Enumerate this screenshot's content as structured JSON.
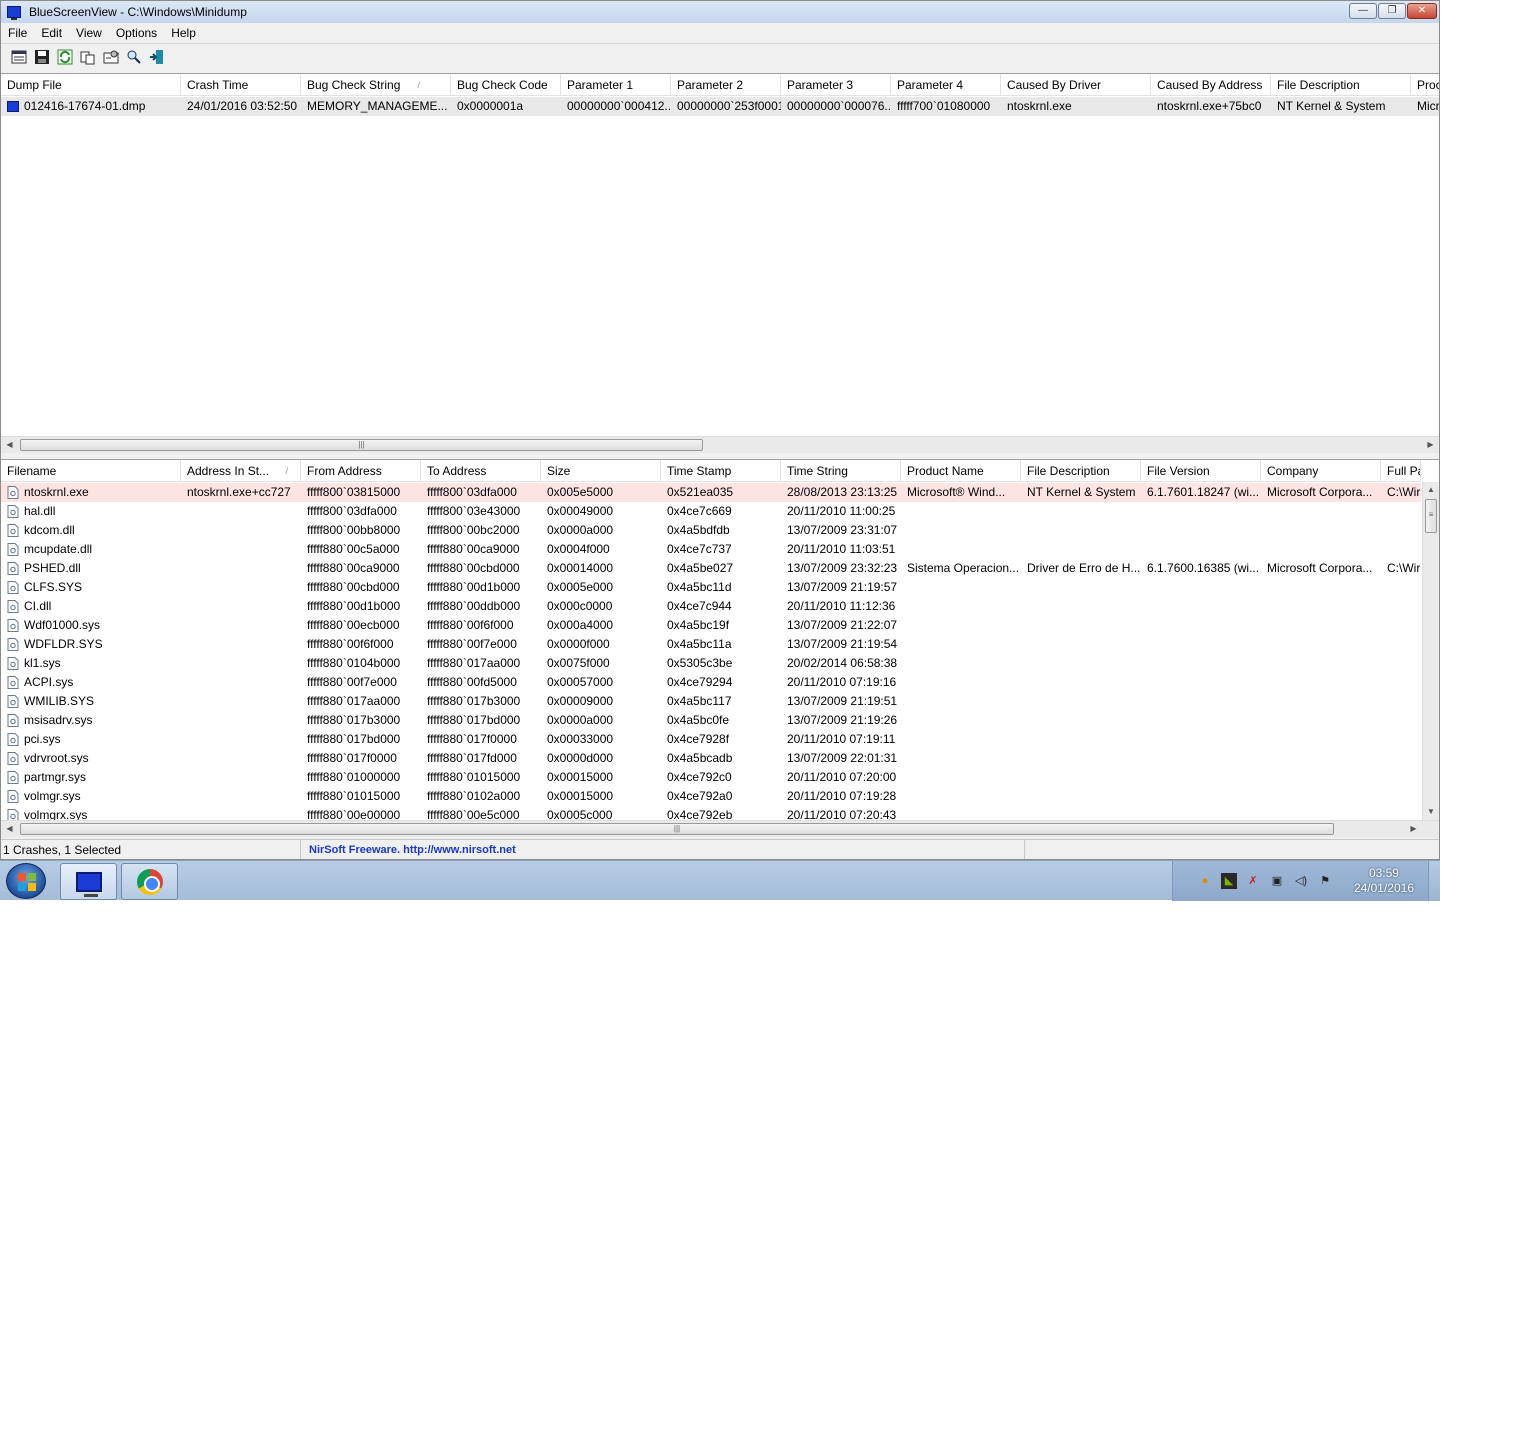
{
  "window": {
    "title": "BlueScreenView  -  C:\\Windows\\Minidump",
    "minimize": "—",
    "maximize": "❐",
    "close": "✕"
  },
  "menu": [
    "File",
    "Edit",
    "View",
    "Options",
    "Help"
  ],
  "toolbar": {
    "icons": [
      "properties-icon",
      "save-icon",
      "refresh-icon",
      "copy-icon",
      "advanced-options-icon",
      "find-icon",
      "exit-icon"
    ]
  },
  "upper": {
    "columns": [
      {
        "label": "Dump File",
        "w": 180
      },
      {
        "label": "Crash Time",
        "w": 120
      },
      {
        "label": "Bug Check String",
        "w": 150,
        "sort": "/"
      },
      {
        "label": "Bug Check Code",
        "w": 110
      },
      {
        "label": "Parameter 1",
        "w": 110
      },
      {
        "label": "Parameter 2",
        "w": 110
      },
      {
        "label": "Parameter 3",
        "w": 110
      },
      {
        "label": "Parameter 4",
        "w": 110
      },
      {
        "label": "Caused By Driver",
        "w": 150
      },
      {
        "label": "Caused By Address",
        "w": 120
      },
      {
        "label": "File Description",
        "w": 140
      },
      {
        "label": "Proc",
        "w": 40
      }
    ],
    "rows": [
      [
        "012416-17674-01.dmp",
        "24/01/2016 03:52:50",
        "MEMORY_MANAGEME...",
        "0x0000001a",
        "00000000`000412...",
        "00000000`253f0001",
        "00000000`000076...",
        "fffff700`01080000",
        "ntoskrnl.exe",
        "ntoskrnl.exe+75bc0",
        "NT Kernel & System",
        "Micr"
      ]
    ]
  },
  "lower": {
    "columns": [
      {
        "label": "Filename",
        "w": 180
      },
      {
        "label": "Address In St...",
        "w": 120,
        "sort": "/"
      },
      {
        "label": "From Address",
        "w": 120
      },
      {
        "label": "To Address",
        "w": 120
      },
      {
        "label": "Size",
        "w": 120
      },
      {
        "label": "Time Stamp",
        "w": 120
      },
      {
        "label": "Time String",
        "w": 120
      },
      {
        "label": "Product Name",
        "w": 120
      },
      {
        "label": "File Description",
        "w": 120
      },
      {
        "label": "File Version",
        "w": 120
      },
      {
        "label": "Company",
        "w": 120
      },
      {
        "label": "Full Pa",
        "w": 40
      }
    ],
    "rows": [
      [
        "ntoskrnl.exe",
        "ntoskrnl.exe+cc727",
        "fffff800`03815000",
        "fffff800`03dfa000",
        "0x005e5000",
        "0x521ea035",
        "28/08/2013 23:13:25",
        "Microsoft® Wind...",
        "NT Kernel & System",
        "6.1.7601.18247 (wi...",
        "Microsoft Corpora...",
        "C:\\Wir"
      ],
      [
        "hal.dll",
        "",
        "fffff800`03dfa000",
        "fffff800`03e43000",
        "0x00049000",
        "0x4ce7c669",
        "20/11/2010 11:00:25",
        "",
        "",
        "",
        "",
        ""
      ],
      [
        "kdcom.dll",
        "",
        "fffff800`00bb8000",
        "fffff800`00bc2000",
        "0x0000a000",
        "0x4a5bdfdb",
        "13/07/2009 23:31:07",
        "",
        "",
        "",
        "",
        ""
      ],
      [
        "mcupdate.dll",
        "",
        "fffff880`00c5a000",
        "fffff880`00ca9000",
        "0x0004f000",
        "0x4ce7c737",
        "20/11/2010 11:03:51",
        "",
        "",
        "",
        "",
        ""
      ],
      [
        "PSHED.dll",
        "",
        "fffff880`00ca9000",
        "fffff880`00cbd000",
        "0x00014000",
        "0x4a5be027",
        "13/07/2009 23:32:23",
        "Sistema Operacion...",
        "Driver de Erro de H...",
        "6.1.7600.16385 (wi...",
        "Microsoft Corpora...",
        "C:\\Wir"
      ],
      [
        "CLFS.SYS",
        "",
        "fffff880`00cbd000",
        "fffff880`00d1b000",
        "0x0005e000",
        "0x4a5bc11d",
        "13/07/2009 21:19:57",
        "",
        "",
        "",
        "",
        ""
      ],
      [
        "CI.dll",
        "",
        "fffff880`00d1b000",
        "fffff880`00ddb000",
        "0x000c0000",
        "0x4ce7c944",
        "20/11/2010 11:12:36",
        "",
        "",
        "",
        "",
        ""
      ],
      [
        "Wdf01000.sys",
        "",
        "fffff880`00ecb000",
        "fffff880`00f6f000",
        "0x000a4000",
        "0x4a5bc19f",
        "13/07/2009 21:22:07",
        "",
        "",
        "",
        "",
        ""
      ],
      [
        "WDFLDR.SYS",
        "",
        "fffff880`00f6f000",
        "fffff880`00f7e000",
        "0x0000f000",
        "0x4a5bc11a",
        "13/07/2009 21:19:54",
        "",
        "",
        "",
        "",
        ""
      ],
      [
        "kl1.sys",
        "",
        "fffff880`0104b000",
        "fffff880`017aa000",
        "0x0075f000",
        "0x5305c3be",
        "20/02/2014 06:58:38",
        "",
        "",
        "",
        "",
        ""
      ],
      [
        "ACPI.sys",
        "",
        "fffff880`00f7e000",
        "fffff880`00fd5000",
        "0x00057000",
        "0x4ce79294",
        "20/11/2010 07:19:16",
        "",
        "",
        "",
        "",
        ""
      ],
      [
        "WMILIB.SYS",
        "",
        "fffff880`017aa000",
        "fffff880`017b3000",
        "0x00009000",
        "0x4a5bc117",
        "13/07/2009 21:19:51",
        "",
        "",
        "",
        "",
        ""
      ],
      [
        "msisadrv.sys",
        "",
        "fffff880`017b3000",
        "fffff880`017bd000",
        "0x0000a000",
        "0x4a5bc0fe",
        "13/07/2009 21:19:26",
        "",
        "",
        "",
        "",
        ""
      ],
      [
        "pci.sys",
        "",
        "fffff880`017bd000",
        "fffff880`017f0000",
        "0x00033000",
        "0x4ce7928f",
        "20/11/2010 07:19:11",
        "",
        "",
        "",
        "",
        ""
      ],
      [
        "vdrvroot.sys",
        "",
        "fffff880`017f0000",
        "fffff880`017fd000",
        "0x0000d000",
        "0x4a5bcadb",
        "13/07/2009 22:01:31",
        "",
        "",
        "",
        "",
        ""
      ],
      [
        "partmgr.sys",
        "",
        "fffff880`01000000",
        "fffff880`01015000",
        "0x00015000",
        "0x4ce792c0",
        "20/11/2010 07:20:00",
        "",
        "",
        "",
        "",
        ""
      ],
      [
        "volmgr.sys",
        "",
        "fffff880`01015000",
        "fffff880`0102a000",
        "0x00015000",
        "0x4ce792a0",
        "20/11/2010 07:19:28",
        "",
        "",
        "",
        "",
        ""
      ],
      [
        "volmgrx.sys",
        "",
        "fffff880`00e00000",
        "fffff880`00e5c000",
        "0x0005c000",
        "0x4ce792eb",
        "20/11/2010 07:20:43",
        "",
        "",
        "",
        "",
        ""
      ]
    ],
    "highlight_color": "#ffe4e4"
  },
  "status": {
    "count": "1 Crashes, 1 Selected",
    "link": "NirSoft Freeware.  http://www.nirsoft.net"
  },
  "taskbar": {
    "apps": [
      "bluescreenview-icon",
      "chrome-icon"
    ],
    "time": "03:59",
    "date": "24/01/2016",
    "tray_icons": [
      "media-player-icon",
      "nvidia-icon",
      "kaspersky-icon",
      "network-icon",
      "volume-icon",
      "action-center-flag-icon"
    ]
  }
}
